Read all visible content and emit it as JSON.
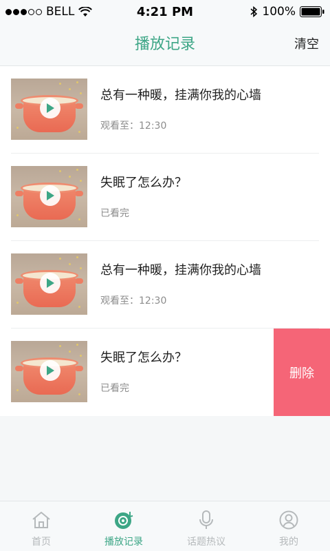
{
  "status_bar": {
    "carrier": "BELL",
    "time": "4:21 PM",
    "battery": "100%"
  },
  "nav": {
    "title": "播放记录",
    "clear_label": "清空"
  },
  "list": {
    "items": [
      {
        "title": "总有一种暖，挂满你我的心墙",
        "status": "观看至：12:30"
      },
      {
        "title": "失眠了怎么办？",
        "status": "已看完"
      },
      {
        "title": "总有一种暖，挂满你我的心墙",
        "status": "观看至：12:30"
      },
      {
        "title": "失眠了怎么办？",
        "status": "已看完"
      }
    ],
    "delete_label": "删除"
  },
  "tabs": [
    {
      "label": "首页",
      "icon": "home-icon",
      "active": false
    },
    {
      "label": "播放记录",
      "icon": "record-icon",
      "active": true
    },
    {
      "label": "话题热议",
      "icon": "mic-icon",
      "active": false
    },
    {
      "label": "我的",
      "icon": "profile-icon",
      "active": false
    }
  ],
  "colors": {
    "accent": "#3da686",
    "delete": "#f56577",
    "inactive": "#b5b9bb"
  }
}
